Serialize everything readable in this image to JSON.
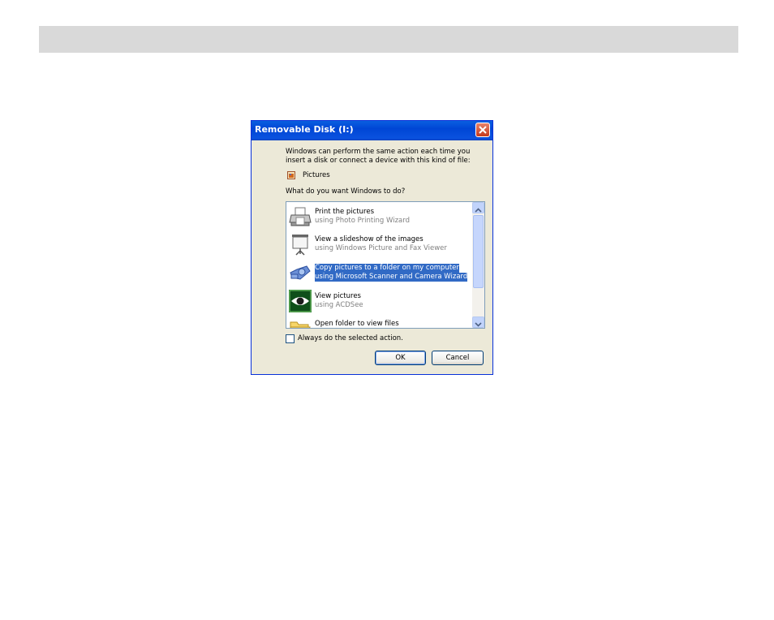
{
  "dialog": {
    "title": "Removable Disk (I:)",
    "intro": "Windows can perform the same action each time you insert a disk or connect a device with this kind of file:",
    "content_type": "Pictures",
    "question": "What do you want Windows to do?",
    "actions": [
      {
        "title": "Print the pictures",
        "subtitle": "using Photo Printing Wizard",
        "icon": "printer-icon"
      },
      {
        "title": "View a slideshow of the images",
        "subtitle": "using Windows Picture and Fax Viewer",
        "icon": "projector-screen-icon"
      },
      {
        "title": "Copy pictures to a folder on my computer",
        "subtitle": "using Microsoft Scanner and Camera Wizard",
        "icon": "camera-icon",
        "selected": true
      },
      {
        "title": "View pictures",
        "subtitle": "using ACDSee",
        "icon": "eye-icon"
      },
      {
        "title": "Open folder to view files",
        "subtitle": "",
        "icon": "folder-icon"
      }
    ],
    "always_label": "Always do the selected action.",
    "ok_label": "OK",
    "cancel_label": "Cancel"
  },
  "colors": {
    "titlebar": "#0054e3",
    "selection": "#316ac5",
    "dialog_bg": "#ece9d8"
  }
}
